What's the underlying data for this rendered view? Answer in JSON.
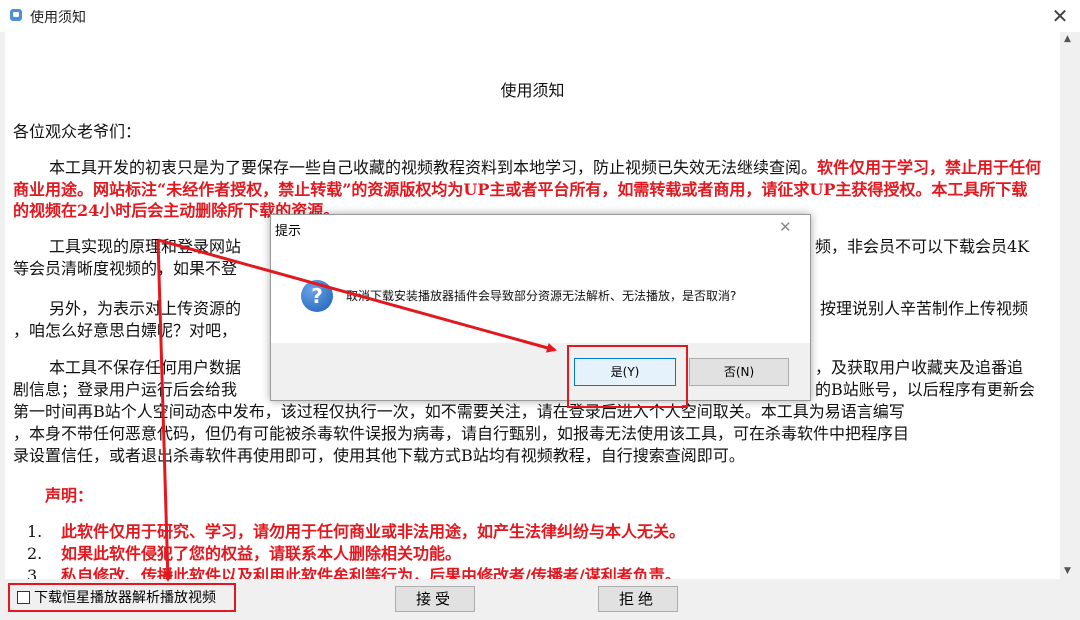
{
  "window": {
    "title": "使用须知",
    "close_glyph": "✕"
  },
  "notice": {
    "title": "使用须知",
    "salutation": "各位观众老爷们：",
    "p1_normal": "本工具开发的初衷只是为了要保存一些自己收藏的视频教程资料到本地学习，防止视频已失效无法继续查阅。",
    "p1_red": "软件仅用于学习，禁止用于任何商业用途。网站标注“未经作者授权，禁止转载”的资源版权均为UP主或者平台所有，如需转载或者商用，请征求UP主获得授权。本工具所下载的视频在24小时后会主动删除所下载的资源。",
    "p2": "工具实现的原理和登录网站",
    "p2_right": "频，非会员不可以下载会员4K",
    "p2_line2": "等会员清晰度视频的，如果不登",
    "p3": "另外，为表示对上传资源的",
    "p3_right": "按理说别人辛苦制作上传视频",
    "p3_line2": "，咱怎么好意思白嫖呢？对吧，",
    "p4_line1_left": "本工具不保存任何用户数据",
    "p4_line1_right": "，及获取用户收藏夹及追番追",
    "p4_line2_left": "剧信息；登录用户运行后会给我",
    "p4_line2_right": "的B站账号，以后程序有更新会",
    "p4_line3": "第一时间再B站个人空间动态中发布，该过程仅执行一次，如不需要关注，请在登录后进入个人空间取关。本工具为易语言编写",
    "p4_line4": "，本身不带任何恶意代码，但仍有可能被杀毒软件误报为病毒，请自行甄别，如报毒无法使用该工具，可在杀毒软件中把程序目",
    "p4_line5": "录设置信任，或者退出杀毒软件再使用即可，使用其他下载方式B站均有视频教程，自行搜索查阅即可。",
    "declaration_heading": "声明：",
    "declarations": [
      {
        "num": "1.",
        "text": "此软件仅用于研究、学习，请勿用于任何商业或非法用途，如产生法律纠纷与本人无关。"
      },
      {
        "num": "2.",
        "text": "如果此软件侵犯了您的权益，请联系本人删除相关功能。"
      },
      {
        "num": "3.",
        "text": "私自修改、传播此软件以及利用此软件牟利等行为，后果由修改者/传播者/谋利者负责。"
      }
    ]
  },
  "footer": {
    "checkbox_label": "下载恒星播放器解析播放视频",
    "accept_label": "接受",
    "reject_label": "拒绝"
  },
  "dialog": {
    "title": "提示",
    "close_glyph": "✕",
    "icon_glyph": "?",
    "message": "取消下载安装播放器插件会导致部分资源无法解析、无法播放，是否取消?",
    "yes_label": "是(Y)",
    "no_label": "否(N)"
  },
  "colors": {
    "highlight_red": "#e3181f",
    "question_blue": "#1a5fb4"
  }
}
